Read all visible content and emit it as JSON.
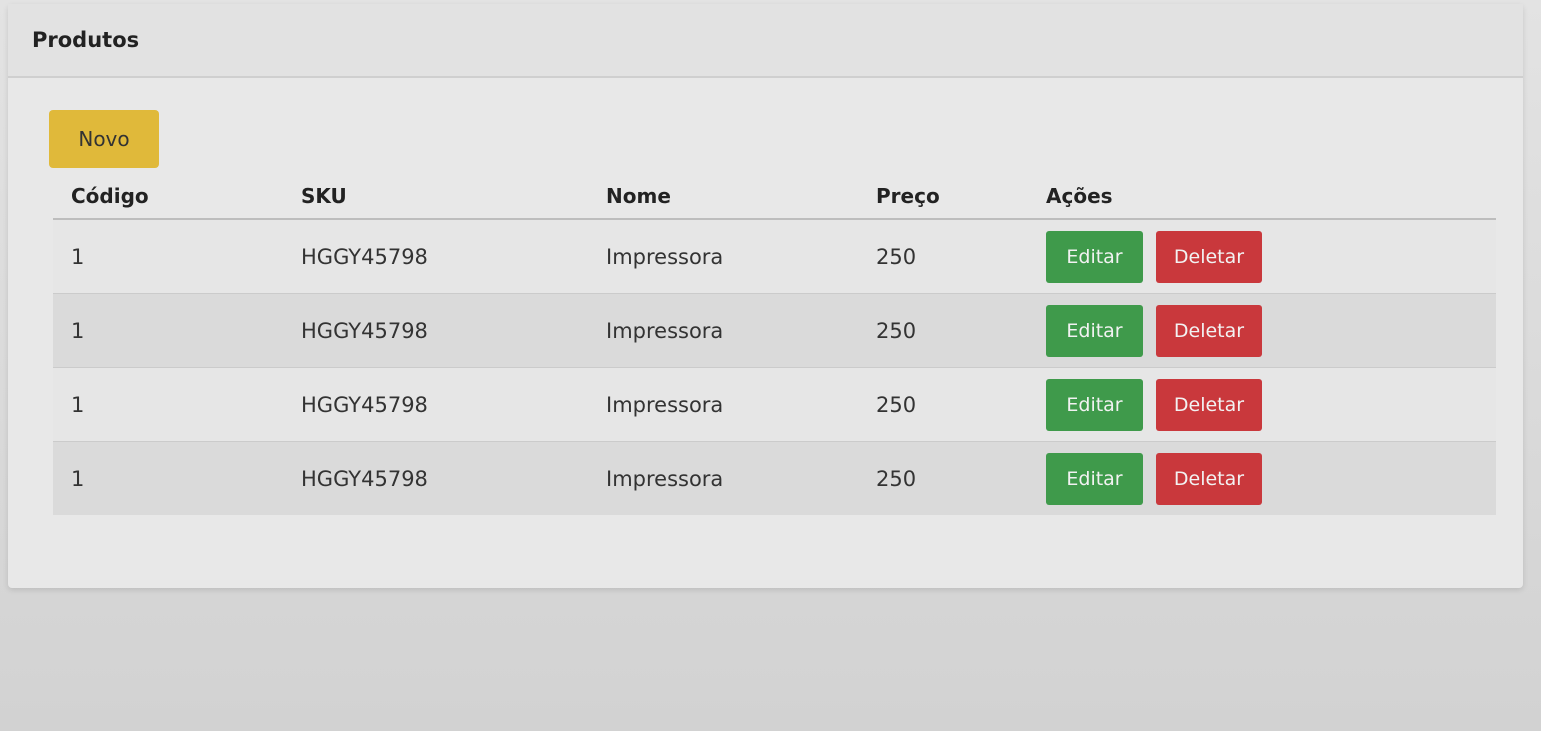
{
  "header": {
    "title": "Produtos"
  },
  "actions": {
    "new_label": "Novo"
  },
  "table": {
    "columns": [
      "Código",
      "SKU",
      "Nome",
      "Preço",
      "Ações"
    ],
    "rows": [
      {
        "codigo": "1",
        "sku": "HGGY45798",
        "nome": "Impressora",
        "preco": "250",
        "edit_label": "Editar",
        "delete_label": "Deletar"
      },
      {
        "codigo": "1",
        "sku": "HGGY45798",
        "nome": "Impressora",
        "preco": "250",
        "edit_label": "Editar",
        "delete_label": "Deletar"
      },
      {
        "codigo": "1",
        "sku": "HGGY45798",
        "nome": "Impressora",
        "preco": "250",
        "edit_label": "Editar",
        "delete_label": "Deletar"
      },
      {
        "codigo": "1",
        "sku": "HGGY45798",
        "nome": "Impressora",
        "preco": "250",
        "edit_label": "Editar",
        "delete_label": "Deletar"
      }
    ]
  },
  "colors": {
    "new_button": "#e0b93a",
    "edit_button": "#3f9a4b",
    "delete_button": "#c9383c"
  }
}
